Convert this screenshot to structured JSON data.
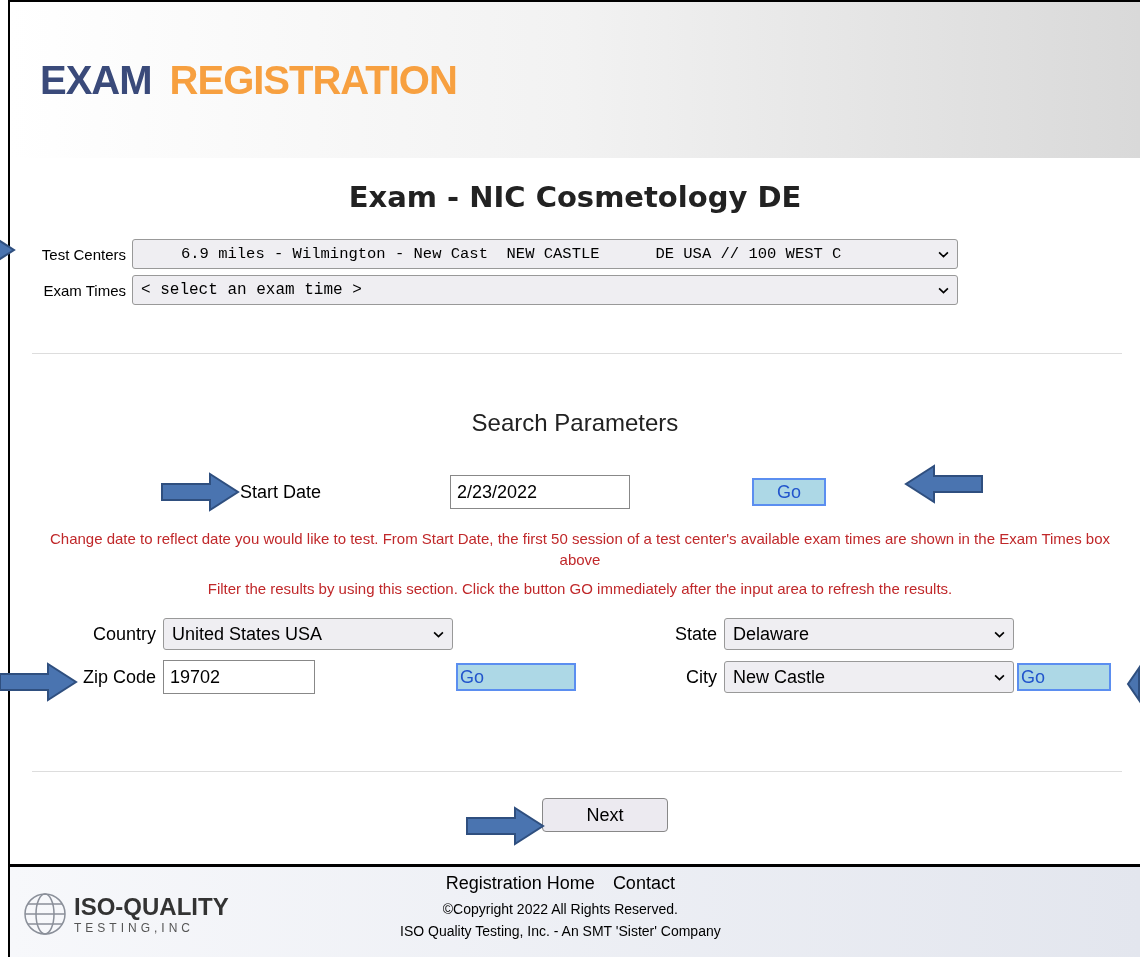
{
  "header": {
    "title_part1": "EXAM",
    "title_part2": "REGISTRATION"
  },
  "exam_title": "Exam - NIC Cosmetology DE",
  "test_centers": {
    "label": "Test Centers",
    "value": "6.9 miles - Wilmington - New Cast  NEW CASTLE      DE USA // 100 WEST C"
  },
  "exam_times": {
    "label": "Exam Times",
    "value": "< select an exam time >"
  },
  "search": {
    "heading": "Search Parameters",
    "start_date_label": "Start Date",
    "start_date": "2/23/2022",
    "go": "Go",
    "note1": "Change date to reflect date you would like to test. From Start Date, the first 50 session of a test center's available exam times are shown in the Exam Times box above",
    "note2": "Filter the results by using this section. Click the button GO immediately after the input area to refresh the results."
  },
  "filters": {
    "country_label": "Country",
    "country": "United States USA",
    "state_label": "State",
    "state": "Delaware",
    "zip_label": "Zip Code",
    "zip": "19702",
    "zip_go": "Go",
    "city_label": "City",
    "city": "New Castle",
    "city_go": "Go"
  },
  "next": "Next",
  "footer": {
    "logo_main": "ISO-QUALITY",
    "logo_sub": "TESTING,INC",
    "links": [
      "Registration Home",
      "Contact"
    ],
    "copyright": "©Copyright 2022 All Rights Reserved.",
    "company": "ISO Quality Testing, Inc. - An SMT 'Sister' Company"
  }
}
